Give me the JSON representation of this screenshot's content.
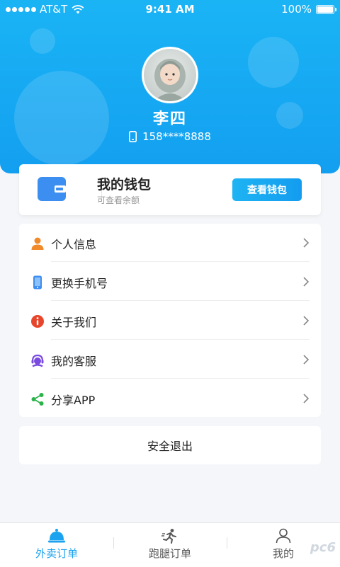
{
  "status_bar": {
    "carrier": "AT&T",
    "time": "9:41 AM",
    "battery": "100%"
  },
  "profile": {
    "name": "李四",
    "phone": "158****8888"
  },
  "wallet": {
    "title": "我的钱包",
    "subtitle": "可查看余额",
    "button": "查看钱包"
  },
  "menu": [
    {
      "label": "个人信息",
      "icon": "person-icon",
      "color": "#f08a2a"
    },
    {
      "label": "更换手机号",
      "icon": "phone-icon",
      "color": "#3d8ef0"
    },
    {
      "label": "关于我们",
      "icon": "info-icon",
      "color": "#e8462c"
    },
    {
      "label": "我的客服",
      "icon": "headset-icon",
      "color": "#7a4be0"
    },
    {
      "label": "分享APP",
      "icon": "share-icon",
      "color": "#2bb34a"
    }
  ],
  "logout": "安全退出",
  "tabs": [
    {
      "label": "外卖订单",
      "icon": "bell-icon",
      "active": true
    },
    {
      "label": "跑腿订单",
      "icon": "runner-icon",
      "active": false
    },
    {
      "label": "我的",
      "icon": "user-icon",
      "active": false
    }
  ],
  "watermark": "pc6",
  "colors": {
    "primary": "#139ff0",
    "background": "#f4f6f9"
  }
}
